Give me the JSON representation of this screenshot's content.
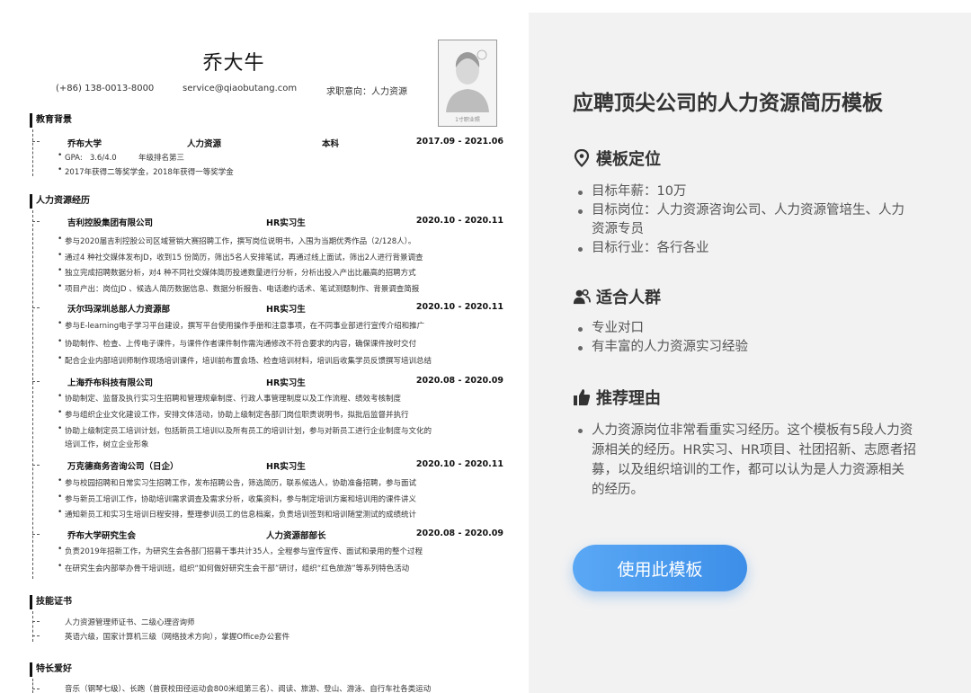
{
  "resume": {
    "name": "乔大牛",
    "phone": "(+86) 138-0013-8000",
    "email": "service@qiaobutang.com",
    "intent": "求职意向：人力资源",
    "photo_caption": "1寸职业照",
    "education": {
      "title": "教育背景",
      "school": "乔布大学",
      "major": "人力资源",
      "degree": "本科",
      "date": "2017.09 - 2021.06",
      "gpa_label": "GPA:",
      "gpa": "3.6/4.0",
      "rank": "年级排名第三",
      "award": "2017年获得二等奖学金，2018年获得一等奖学金"
    },
    "experience": {
      "title": "人力资源经历",
      "jobs": [
        {
          "company": "吉利控股集团有限公司",
          "role": "HR实习生",
          "date": "2020.10 - 2020.11",
          "bullets": [
            "参与2020届吉利控股公司区域营销大赛招聘工作，撰写岗位说明书，入围为当期优秀作品（2/128人）。",
            "通过4 种社交媒体发布JD，收到15 份简历，筛出5名人安排笔试，再通过线上面试，筛出2人进行背景调查",
            "独立完成招聘数据分析，对4 种不同社交媒体简历投递数量进行分析，分析出投入产出比最高的招聘方式",
            "项目产出：岗位JD 、候选人简历数据信息、数据分析报告、电话邀约话术、笔试测题制作、背景调查简报"
          ]
        },
        {
          "company": "沃尔玛深圳总部人力资源部",
          "role": "HR实习生",
          "date": "2020.10 - 2020.11",
          "bullets": [
            "参与E-learning电子学习平台建设，撰写平台使用操作手册和注意事项，在不同事业部进行宣传介绍和推广",
            "协助制作、检查、上传电子课件，与课件作者课件制作需沟通修改不符合要求的内容，确保课件按时交付",
            "配合企业内部培训师制作现场培训课件，培训前布置会场、检查培训材料，培训后收集学员反馈撰写培训总结"
          ]
        },
        {
          "company": "上海乔布科技有限公司",
          "role": "HR实习生",
          "date": "2020.08 - 2020.09",
          "bullets": [
            "协助制定、监督及执行实习生招聘和管理规章制度、行政人事管理制度以及工作流程、绩效考核制度",
            "参与组织企业文化建设工作，安排文体活动，协助上级制定各部门岗位职责说明书，拟批后监督并执行",
            "协助上级制定员工培训计划，包括新员工培训以及所有员工的培训计划，参与对新员工进行企业制度与文化的",
            "培训工作，树立企业形象"
          ]
        },
        {
          "company": "万克德商务咨询公司（日企）",
          "role": "HR实习生",
          "date": "2020.10 - 2020.11",
          "bullets": [
            "参与校园招聘和日常实习生招聘工作，发布招聘公告，筛选简历，联系候选人，协助准备招聘，参与面试",
            "参与新员工培训工作，协助培训需求调查及需求分析，收集资料，参与制定培训方案和培训用的课件讲义",
            "通知新员工和实习生培训日程安排，整理参训员工的信息档案，负责培训签到和培训随堂测试的成绩统计"
          ]
        },
        {
          "company": "乔布大学研究生会",
          "role": "人力资源部部长",
          "date": "2020.08 - 2020.09",
          "bullets": [
            "负责2019年招新工作，为研究生会各部门招募干事共计35人，全程参与宣传宣传、面试和录用的整个过程",
            "在研究生会内部举办骨干培训班，组织“如何做好研究生会干部”研讨，组织“红色旅游”等系列特色活动"
          ]
        }
      ]
    },
    "skills": {
      "title": "技能证书",
      "items": [
        "人力资源管理师证书、二级心理咨询师",
        "英语六级，国家计算机三级（网络技术方向），掌握Office办公套件"
      ]
    },
    "hobbies": {
      "title": "特长爱好",
      "items": [
        "音乐（钢琴七级）、长跑（曾获校田径运动会800米组第三名）、阅读、旅游、登山、游泳、自行车社各类运动"
      ]
    }
  },
  "panel": {
    "title": "应聘顶尖公司的人力资源简历模板",
    "sections": [
      {
        "heading": "模板定位",
        "icon": "location-pin-icon",
        "items": [
          "目标年薪：10万",
          "目标岗位：人力资源咨询公司、人力资源管培生、人力资源专员",
          "目标行业：各行各业"
        ]
      },
      {
        "heading": "适合人群",
        "icon": "people-icon",
        "items": [
          "专业对口",
          "有丰富的人力资源实习经验"
        ]
      },
      {
        "heading": "推荐理由",
        "icon": "thumbs-up-icon",
        "items": [
          "人力资源岗位非常看重实习经历。这个模板有5段人力资源相关的经历。HR实习、HR项目、社团招新、志愿者招募，以及组织培训的工作，都可以认为是人力资源相关的经历。"
        ]
      }
    ],
    "button_label": "使用此模板"
  }
}
